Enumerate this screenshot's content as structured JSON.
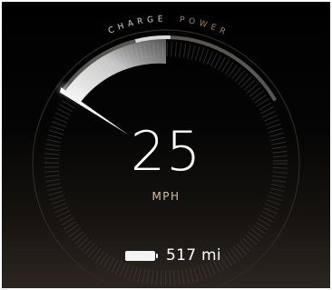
{
  "gauge": {
    "charge_label": "CHARGE",
    "power_label": "POWER",
    "charge_level": 0.3
  },
  "speed": {
    "value": "25",
    "unit": "MPH"
  },
  "range": {
    "value": "517 mi",
    "battery_icon": "battery-full-icon"
  },
  "colors": {
    "unit_accent": "#d7bf9e",
    "indicator": "#ffffff",
    "background_dark": "#000000",
    "background_bottom": "#2b2620"
  }
}
